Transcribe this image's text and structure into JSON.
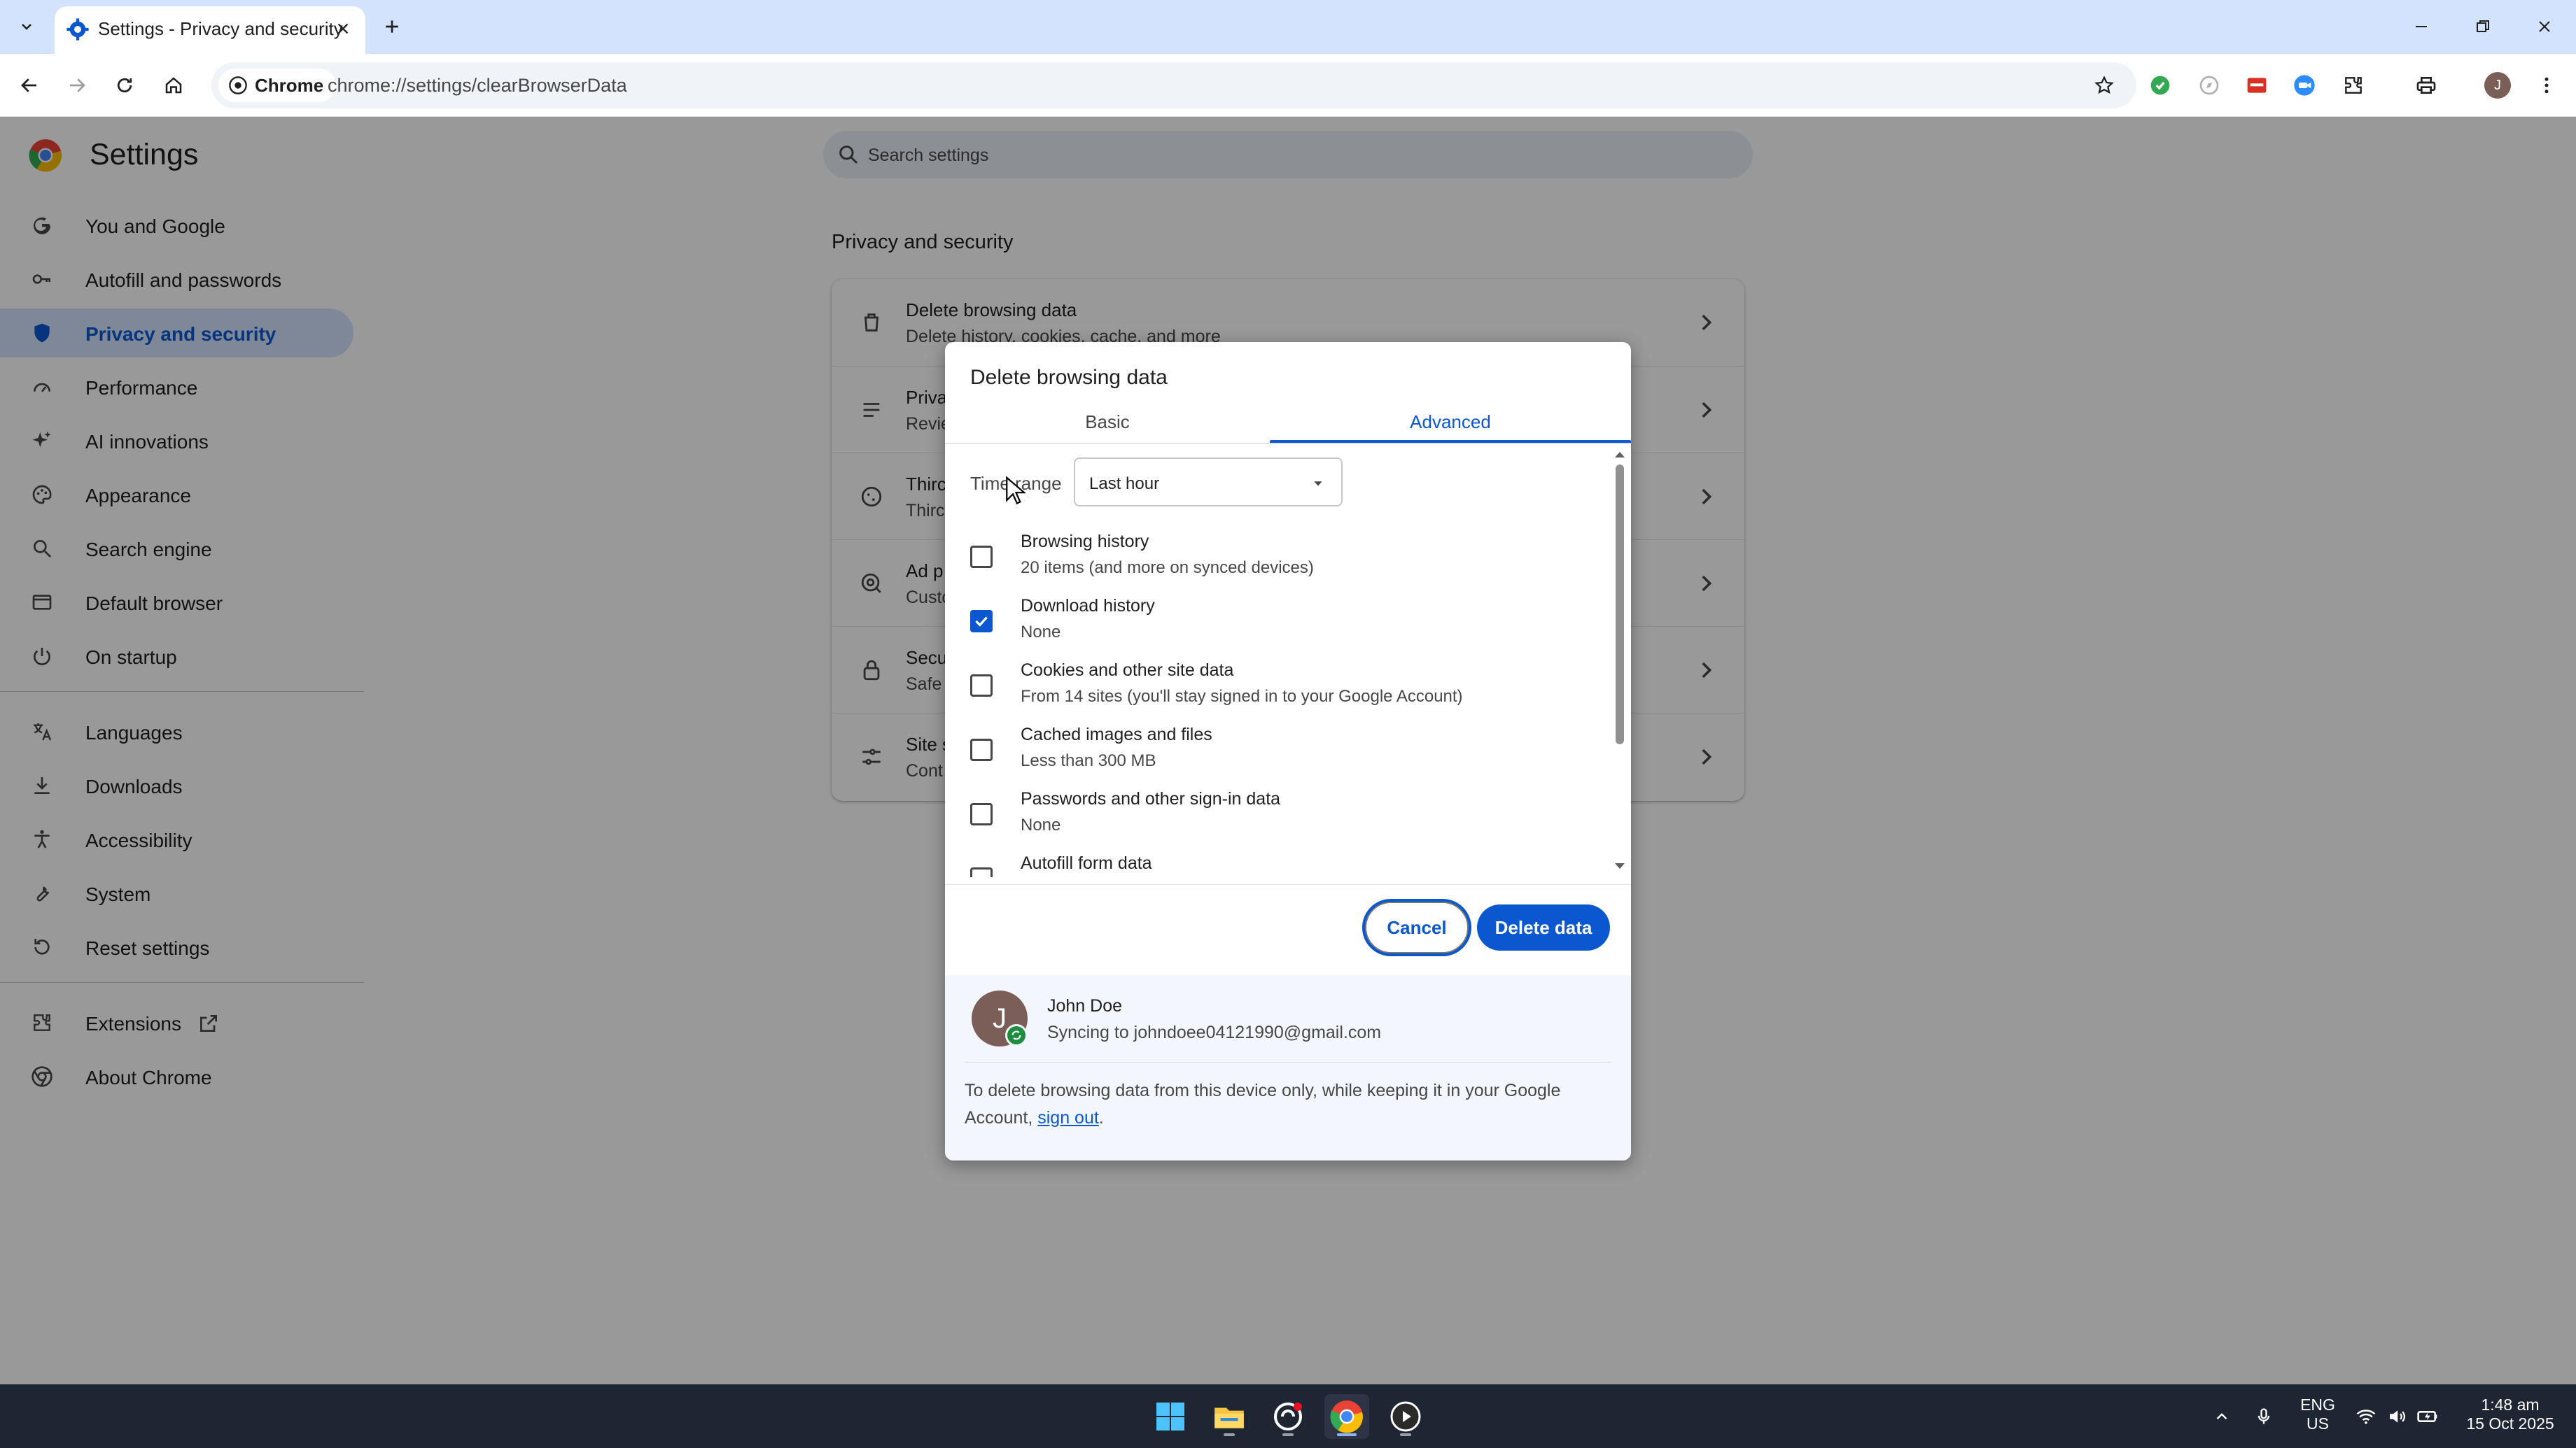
{
  "browser": {
    "tab": {
      "title": "Settings - Privacy and security"
    },
    "omnibox": {
      "chip_label": "Chrome",
      "url": "chrome://settings/clearBrowserData"
    }
  },
  "settings": {
    "title": "Settings",
    "search_placeholder": "Search settings",
    "nav": [
      {
        "label": "You and Google",
        "icon": "google-g-icon"
      },
      {
        "label": "Autofill and passwords",
        "icon": "key-icon"
      },
      {
        "label": "Privacy and security",
        "icon": "shield-icon",
        "active": true
      },
      {
        "label": "Performance",
        "icon": "speedometer-icon"
      },
      {
        "label": "AI innovations",
        "icon": "sparkle-icon"
      },
      {
        "label": "Appearance",
        "icon": "palette-icon"
      },
      {
        "label": "Search engine",
        "icon": "search-icon"
      },
      {
        "label": "Default browser",
        "icon": "browser-window-icon"
      },
      {
        "label": "On startup",
        "icon": "power-icon"
      },
      {
        "label": "Languages",
        "icon": "translate-icon"
      },
      {
        "label": "Downloads",
        "icon": "download-icon"
      },
      {
        "label": "Accessibility",
        "icon": "accessibility-icon"
      },
      {
        "label": "System",
        "icon": "wrench-icon"
      },
      {
        "label": "Reset settings",
        "icon": "reset-icon"
      },
      {
        "label": "Extensions",
        "icon": "puzzle-icon"
      },
      {
        "label": "About Chrome",
        "icon": "chrome-icon"
      }
    ],
    "section_title": "Privacy and security",
    "rows": [
      {
        "title": "Delete browsing data",
        "subtitle": "Delete history, cookies, cache, and more"
      },
      {
        "title": "Priva",
        "subtitle": "Revie"
      },
      {
        "title": "Thirc",
        "subtitle": "Thirc"
      },
      {
        "title": "Ad p",
        "subtitle": "Custo"
      },
      {
        "title": "Secu",
        "subtitle": "Safe"
      },
      {
        "title": "Site s",
        "subtitle": "Cont"
      }
    ]
  },
  "dialog": {
    "title": "Delete browsing data",
    "tabs": {
      "basic": "Basic",
      "advanced": "Advanced"
    },
    "time_range_label": "Time range",
    "time_range_value": "Last hour",
    "options": [
      {
        "title": "Browsing history",
        "subtitle": "20 items (and more on synced devices)",
        "checked": false
      },
      {
        "title": "Download history",
        "subtitle": "None",
        "checked": true
      },
      {
        "title": "Cookies and other site data",
        "subtitle": "From 14 sites (you'll stay signed in to your Google Account)",
        "checked": false
      },
      {
        "title": "Cached images and files",
        "subtitle": "Less than 300 MB",
        "checked": false
      },
      {
        "title": "Passwords and other sign-in data",
        "subtitle": "None",
        "checked": false
      },
      {
        "title": "Autofill form data",
        "subtitle": "",
        "checked": false
      }
    ],
    "cancel_label": "Cancel",
    "delete_label": "Delete data",
    "account": {
      "initial": "J",
      "name": "John Doe",
      "sync_text": "Syncing to johndoee04121990@gmail.com"
    },
    "footer_note_prefix": "To delete browsing data from this device only, while keeping it in your Google Account, ",
    "footer_note_link": "sign out",
    "footer_note_suffix": "."
  },
  "taskbar": {
    "lang_line1": "ENG",
    "lang_line2": "US",
    "time": "1:48 am",
    "date": "15 Oct 2025"
  },
  "colors": {
    "accent": "#0b57d0",
    "active_nav_bg": "#d3e3fd",
    "taskbar_bg": "#1f2633"
  }
}
